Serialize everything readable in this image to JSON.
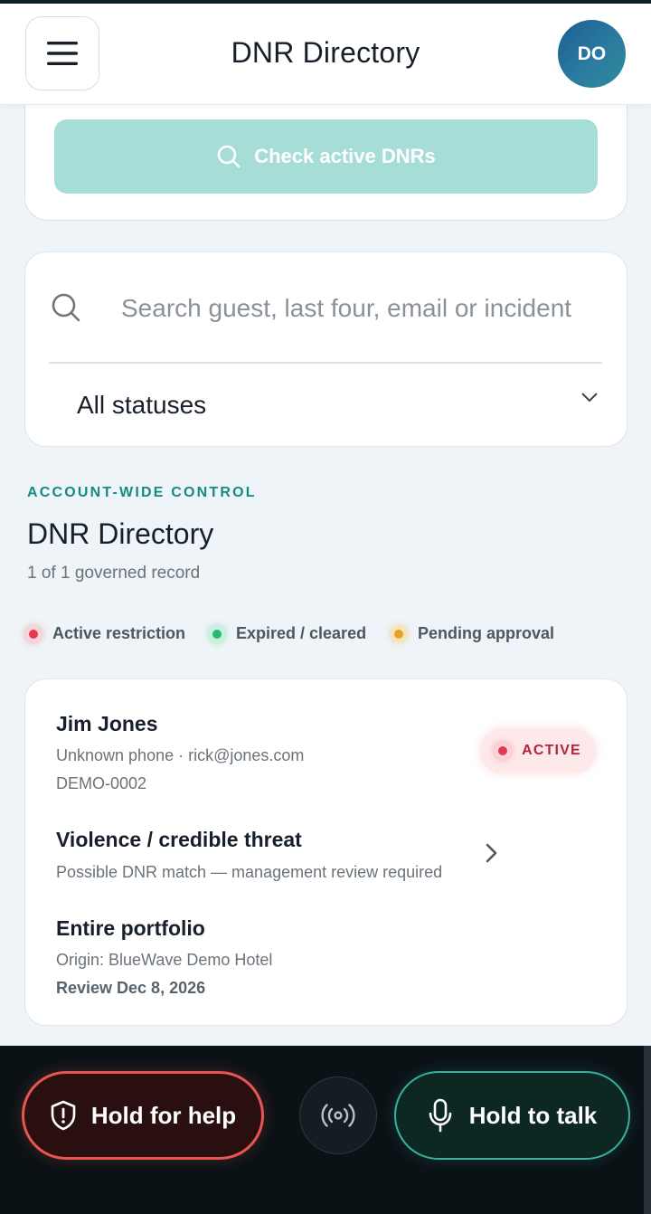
{
  "header": {
    "title": "DNR Directory",
    "avatar_initials": "DO"
  },
  "check": {
    "label": "Check active DNRs"
  },
  "search": {
    "placeholder": "Search guest, last four, email or incident",
    "value": ""
  },
  "filter": {
    "selected": "All statuses"
  },
  "section": {
    "eyebrow": "ACCOUNT-WIDE CONTROL",
    "title": "DNR Directory",
    "subtitle": "1 of 1 governed record"
  },
  "legend": [
    {
      "label": "Active restriction",
      "color": "#e23a4e"
    },
    {
      "label": "Expired / cleared",
      "color": "#2bb673"
    },
    {
      "label": "Pending approval",
      "color": "#e4a329"
    }
  ],
  "record": {
    "name": "Jim Jones",
    "contact": "Unknown phone · rick@jones.com",
    "id": "DEMO-0002",
    "status": "ACTIVE",
    "reason": "Violence / credible threat",
    "note": "Possible DNR match — management review required",
    "scope": "Entire portfolio",
    "origin": "Origin: BlueWave Demo Hotel",
    "review": "Review Dec 8, 2026"
  },
  "bottom": {
    "help_label": "Hold for help",
    "talk_label": "Hold to talk"
  },
  "colors": {
    "accent": "#138a86",
    "danger": "#e8564f",
    "talk": "#36b29e"
  }
}
